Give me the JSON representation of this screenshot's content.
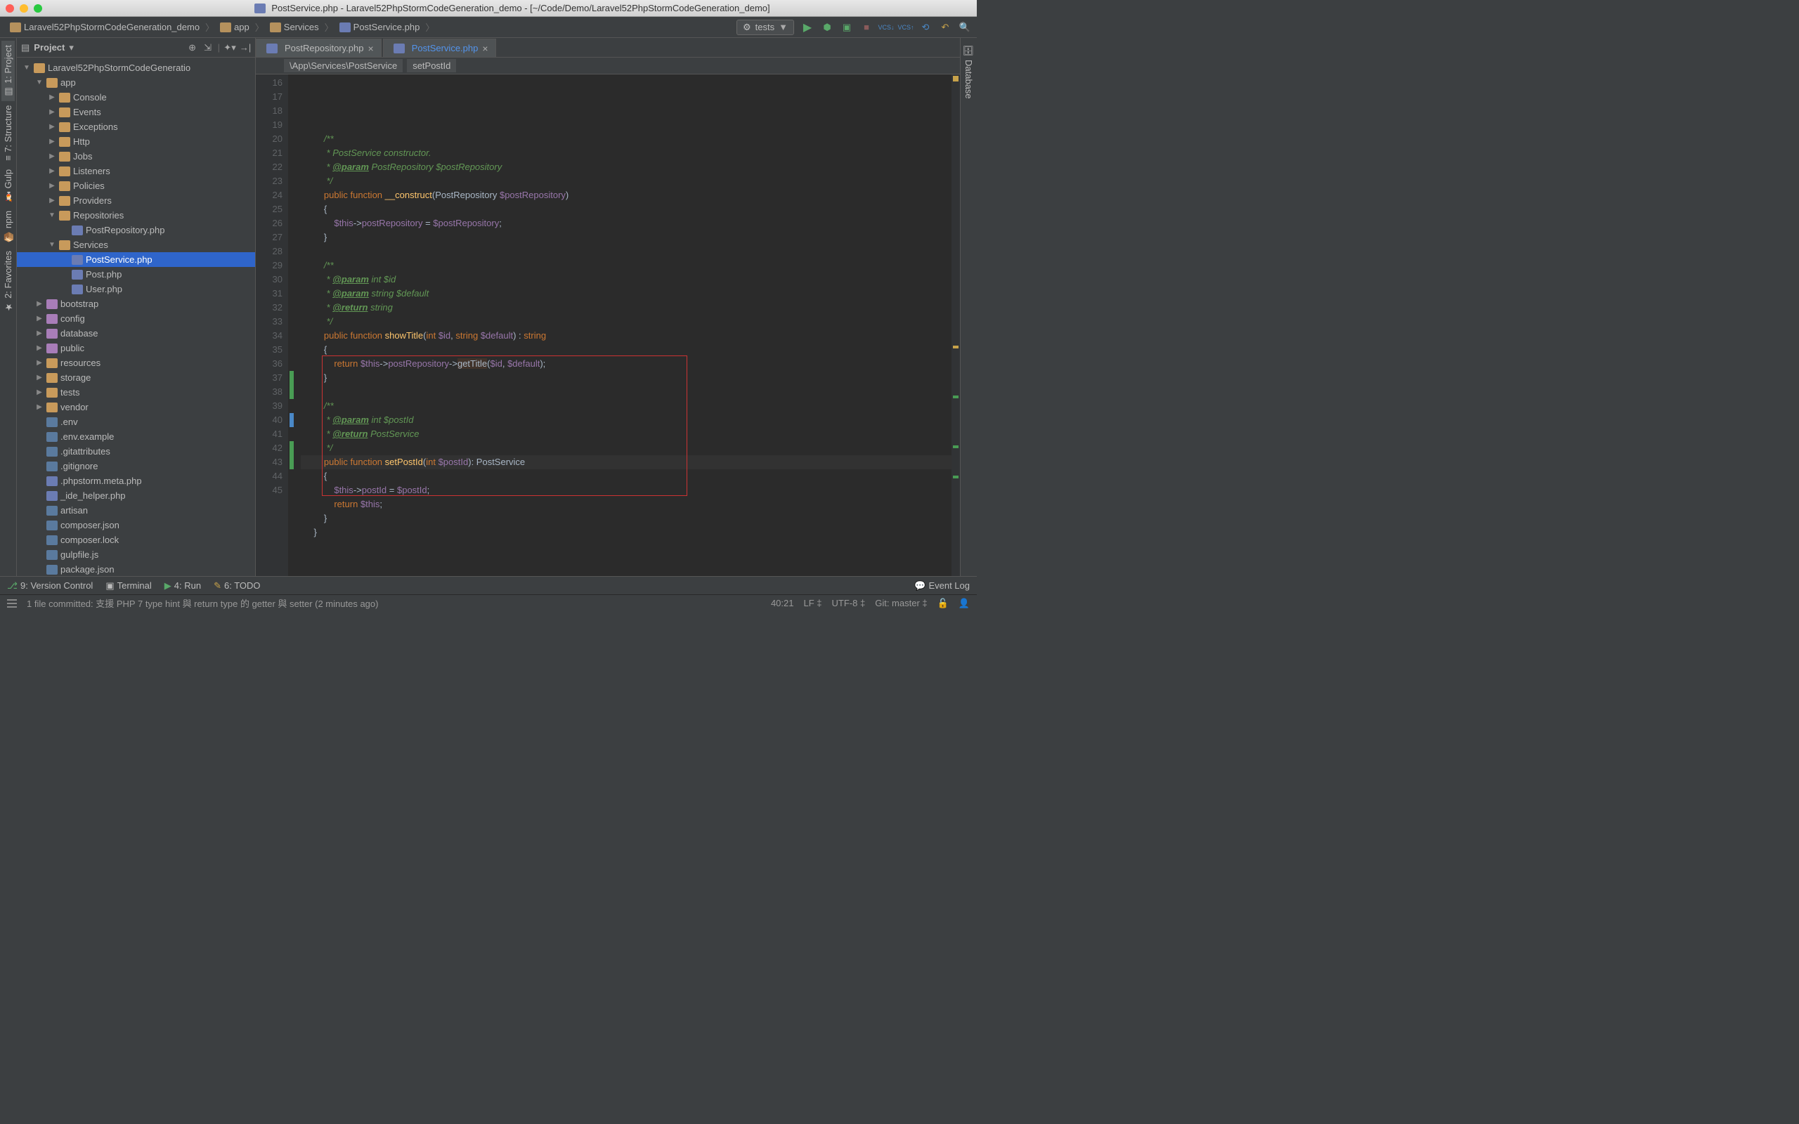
{
  "title": {
    "file_icon": "php",
    "text": "PostService.php - Laravel52PhpStormCodeGeneration_demo - [~/Code/Demo/Laravel52PhpStormCodeGeneration_demo]"
  },
  "breadcrumbs": [
    {
      "icon": "folder",
      "label": "Laravel52PhpStormCodeGeneration_demo"
    },
    {
      "icon": "folder",
      "label": "app"
    },
    {
      "icon": "folder",
      "label": "Services"
    },
    {
      "icon": "php",
      "label": "PostService.php"
    }
  ],
  "run_config": "tests",
  "toolbar_icons": [
    "run",
    "debug",
    "coverage",
    "stop",
    "vcs-update",
    "vcs-commit",
    "history",
    "revert",
    "search"
  ],
  "left_tabs": [
    {
      "label": "1: Project",
      "active": true
    },
    {
      "label": "7: Structure",
      "active": false
    },
    {
      "label": "Gulp",
      "active": false
    },
    {
      "label": "npm",
      "active": false
    },
    {
      "label": "2: Favorites",
      "active": false
    }
  ],
  "right_tabs": [
    {
      "label": "Database",
      "active": false
    }
  ],
  "project": {
    "title": "Project",
    "head_icons": [
      "target",
      "collapse",
      "settings",
      "hide"
    ],
    "tree": [
      {
        "d": 0,
        "a": "open",
        "i": "folder",
        "t": "Laravel52PhpStormCodeGeneratio"
      },
      {
        "d": 1,
        "a": "open",
        "i": "folder",
        "t": "app"
      },
      {
        "d": 2,
        "a": "closed",
        "i": "folder",
        "t": "Console"
      },
      {
        "d": 2,
        "a": "closed",
        "i": "folder",
        "t": "Events"
      },
      {
        "d": 2,
        "a": "closed",
        "i": "folder",
        "t": "Exceptions"
      },
      {
        "d": 2,
        "a": "closed",
        "i": "folder",
        "t": "Http"
      },
      {
        "d": 2,
        "a": "closed",
        "i": "folder",
        "t": "Jobs"
      },
      {
        "d": 2,
        "a": "closed",
        "i": "folder",
        "t": "Listeners"
      },
      {
        "d": 2,
        "a": "closed",
        "i": "folder",
        "t": "Policies"
      },
      {
        "d": 2,
        "a": "closed",
        "i": "folder",
        "t": "Providers"
      },
      {
        "d": 2,
        "a": "open",
        "i": "folder",
        "t": "Repositories"
      },
      {
        "d": 3,
        "a": "none",
        "i": "php",
        "t": "PostRepository.php"
      },
      {
        "d": 2,
        "a": "open",
        "i": "folder",
        "t": "Services"
      },
      {
        "d": 3,
        "a": "none",
        "i": "php",
        "t": "PostService.php",
        "sel": true
      },
      {
        "d": 3,
        "a": "none",
        "i": "php",
        "t": "Post.php"
      },
      {
        "d": 3,
        "a": "none",
        "i": "php",
        "t": "User.php"
      },
      {
        "d": 1,
        "a": "closed",
        "i": "folder-purple",
        "t": "bootstrap"
      },
      {
        "d": 1,
        "a": "closed",
        "i": "folder-purple",
        "t": "config"
      },
      {
        "d": 1,
        "a": "closed",
        "i": "folder-purple",
        "t": "database"
      },
      {
        "d": 1,
        "a": "closed",
        "i": "folder-purple",
        "t": "public"
      },
      {
        "d": 1,
        "a": "closed",
        "i": "folder",
        "t": "resources"
      },
      {
        "d": 1,
        "a": "closed",
        "i": "folder",
        "t": "storage"
      },
      {
        "d": 1,
        "a": "closed",
        "i": "folder",
        "t": "tests"
      },
      {
        "d": 1,
        "a": "closed",
        "i": "folder",
        "t": "vendor"
      },
      {
        "d": 1,
        "a": "none",
        "i": "txt",
        "t": ".env"
      },
      {
        "d": 1,
        "a": "none",
        "i": "txt",
        "t": ".env.example"
      },
      {
        "d": 1,
        "a": "none",
        "i": "txt",
        "t": ".gitattributes"
      },
      {
        "d": 1,
        "a": "none",
        "i": "txt",
        "t": ".gitignore"
      },
      {
        "d": 1,
        "a": "none",
        "i": "php",
        "t": ".phpstorm.meta.php"
      },
      {
        "d": 1,
        "a": "none",
        "i": "php",
        "t": "_ide_helper.php"
      },
      {
        "d": 1,
        "a": "none",
        "i": "txt",
        "t": "artisan"
      },
      {
        "d": 1,
        "a": "none",
        "i": "json",
        "t": "composer.json"
      },
      {
        "d": 1,
        "a": "none",
        "i": "txt",
        "t": "composer.lock"
      },
      {
        "d": 1,
        "a": "none",
        "i": "json",
        "t": "gulpfile.js"
      },
      {
        "d": 1,
        "a": "none",
        "i": "json",
        "t": "package.json"
      }
    ]
  },
  "tabs": [
    {
      "label": "PostRepository.php",
      "icon": "php",
      "active": false
    },
    {
      "label": "PostService.php",
      "icon": "php",
      "active": true
    }
  ],
  "code_breadcrumb": [
    "\\App\\Services\\PostService",
    "setPostId"
  ],
  "gutter_start": 16,
  "gutter_end": 45,
  "code_lines": [
    "",
    "        <span class='doc'>/**</span>",
    "        <span class='doc'> * PostService constructor.</span>",
    "        <span class='doc'> * <span class='tag'>@param</span> PostRepository $postRepository</span>",
    "        <span class='doc'> */</span>",
    "        <span class='k'>public</span> <span class='k'>function</span> <span class='fn'>__construct</span>(PostRepository <span class='var'>$postRepository</span>)",
    "        {",
    "            <span class='var'>$this</span>-><span class='var'>postRepository</span> = <span class='var'>$postRepository</span>;",
    "        }",
    "",
    "        <span class='doc'>/**</span>",
    "        <span class='doc'> * <span class='tag'>@param</span> int $id</span>",
    "        <span class='doc'> * <span class='tag'>@param</span> string $default</span>",
    "        <span class='doc'> * <span class='tag'>@return</span> string</span>",
    "        <span class='doc'> */</span>",
    "        <span class='k'>public</span> <span class='k'>function</span> <span class='fn'>showTitle</span>(<span class='k'>int</span> <span class='var'>$id</span>, <span class='k'>string</span> <span class='var'>$default</span>) : <span class='k'>string</span>",
    "        {",
    "            <span class='k'>return</span> <span class='var'>$this</span>-><span class='var'>postRepository</span>-><span class='hl'>getTitle</span>(<span class='var'>$id</span>, <span class='var'>$default</span>);",
    "        }",
    "",
    "        <span class='doc'>/**</span>",
    "        <span class='doc'> * <span class='tag'>@param</span> int $postId</span>",
    "        <span class='doc'> * <span class='tag'>@return</span> PostService</span>",
    "        <span class='doc'> */</span>",
    "        <span class='k'>public</span> <span class='k'>function</span> <span class='fn'>setPostId</span>(<span class='k'>int</span> <span class='var'>$postId</span>): PostService",
    "        {",
    "            <span class='var'>$this</span>-><span class='var'>postId</span> = <span class='var'>$postId</span>;",
    "            <span class='k'>return</span> <span class='var'>$this</span>;",
    "        }",
    "    }"
  ],
  "caret_line_index": 24,
  "highlight_box": {
    "top_line": 20,
    "bottom_line": 29
  },
  "change_marks": [
    {
      "line": 37,
      "type": "green"
    },
    {
      "line": 38,
      "type": "green"
    },
    {
      "line": 40,
      "type": "blue"
    },
    {
      "line": 42,
      "type": "green"
    },
    {
      "line": 43,
      "type": "green"
    }
  ],
  "bottom_tabs": [
    {
      "icon": "vcs",
      "label": "9: Version Control"
    },
    {
      "icon": "term",
      "label": "Terminal"
    },
    {
      "icon": "run",
      "label": "4: Run"
    },
    {
      "icon": "todo",
      "label": "6: TODO"
    }
  ],
  "event_log": "Event Log",
  "status": {
    "message": "1 file committed: 支援 PHP 7 type hint 與 return type 的 getter 與 setter (2 minutes ago)",
    "pos": "40:21",
    "le": "LF",
    "enc": "UTF-8",
    "git": "Git: master",
    "lock": "unlocked"
  }
}
